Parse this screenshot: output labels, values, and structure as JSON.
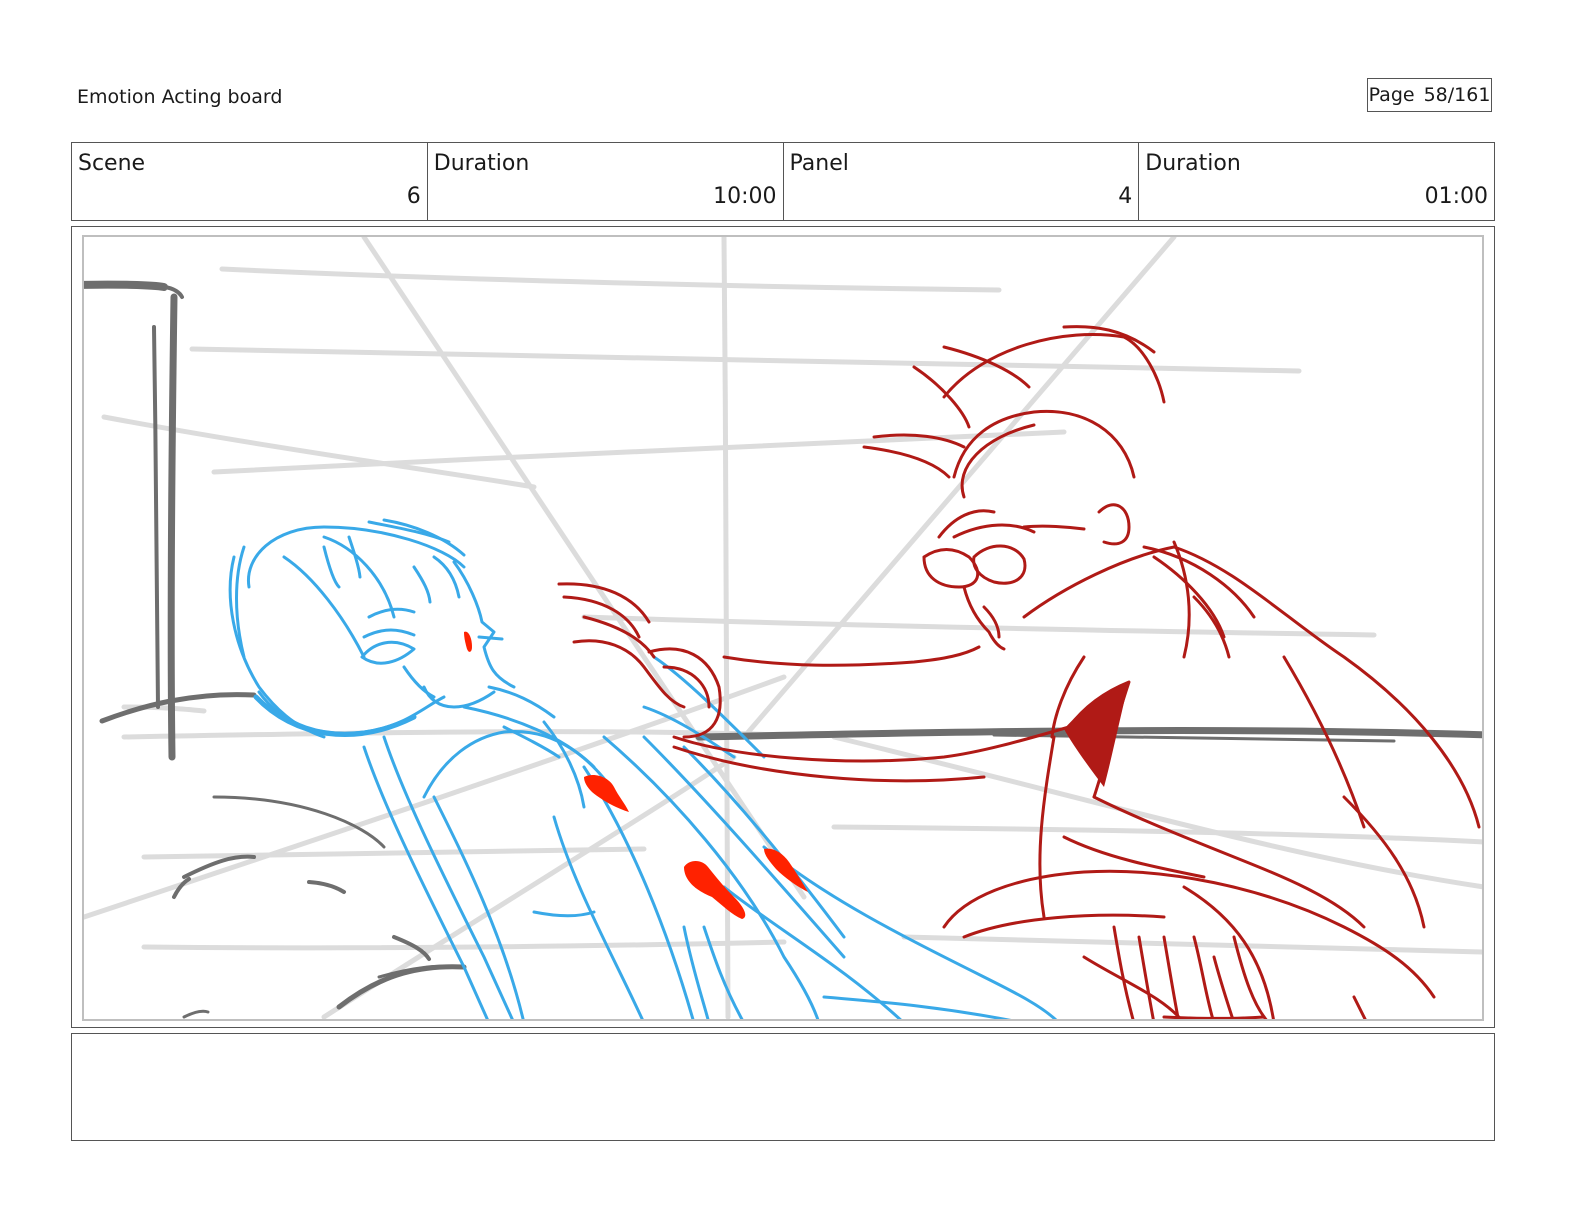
{
  "header": {
    "board_title": "Emotion Acting board",
    "page_label": "Page",
    "page_value": "58/161"
  },
  "info": {
    "scene_label": "Scene",
    "scene_value": "6",
    "scene_duration_label": "Duration",
    "scene_duration_value": "10:00",
    "panel_label": "Panel",
    "panel_value": "4",
    "panel_duration_label": "Duration",
    "panel_duration_value": "01:00"
  },
  "sketch": {
    "colors": {
      "background_lines": "#dcdcdc",
      "structure": "#6e6e6e",
      "victim_character": "#39a9e8",
      "attacker_character": "#b01a16",
      "blood": "#ff2200"
    }
  },
  "notes": {
    "text": ""
  }
}
